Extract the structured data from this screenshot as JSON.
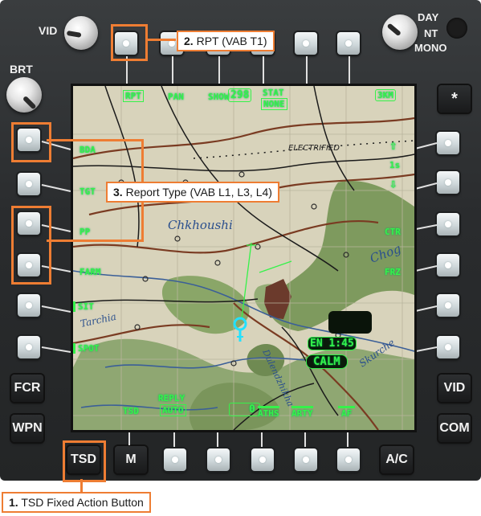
{
  "panel": {
    "vid_knob": "VID",
    "brt_knob": "BRT",
    "mode_knob": {
      "day": "DAY",
      "nt": "NT",
      "mono": "MONO"
    },
    "fab_left": [
      "FCR",
      "WPN"
    ],
    "fab_right": [
      "*",
      "VID",
      "COM"
    ],
    "fab_bottom": [
      "TSD",
      "M",
      "A/C"
    ]
  },
  "screen": {
    "top": {
      "rpt": "RPT",
      "pan": "PAN",
      "show": "SHOW",
      "heading": "298",
      "stat": "STAT",
      "stat_value": "NONE",
      "scale": "3KM"
    },
    "left": {
      "bda": "BDA",
      "tgt": "TGT",
      "pp": "PP",
      "farm": "FARM",
      "sit": "SIT",
      "spot": "SPOT"
    },
    "right": {
      "up": "⇧",
      "range": "1s",
      "down": "⇩",
      "ctr": "CTR",
      "frz": "FRZ"
    },
    "bottom": {
      "tsd": "TSD",
      "reply": "REPLY",
      "reply_value": "AUTO",
      "zero": "0",
      "aths": "ATHS",
      "arty": "ARTY",
      "af": "AF"
    },
    "wind": {
      "dir": "EN",
      "time": "1:45",
      "status": "CALM"
    },
    "map_labels": {
      "town": "Chkhoushi",
      "electrified": "ELECTRIFIED",
      "tarchia": "Tarchia",
      "skurche": "Skurche",
      "lakta": "Dulendzhikha",
      "chog": "Chog"
    }
  },
  "callouts": {
    "c1": {
      "num": "1.",
      "text": "TSD Fixed Action Button"
    },
    "c2": {
      "num": "2.",
      "text": "RPT (VAB T1)"
    },
    "c3": {
      "num": "3.",
      "text": "Report Type (VAB L1, L3, L4)"
    }
  },
  "colors": {
    "symbology": "#35f24a",
    "callout": "#ee7d33",
    "bezel": "#2f3133"
  }
}
